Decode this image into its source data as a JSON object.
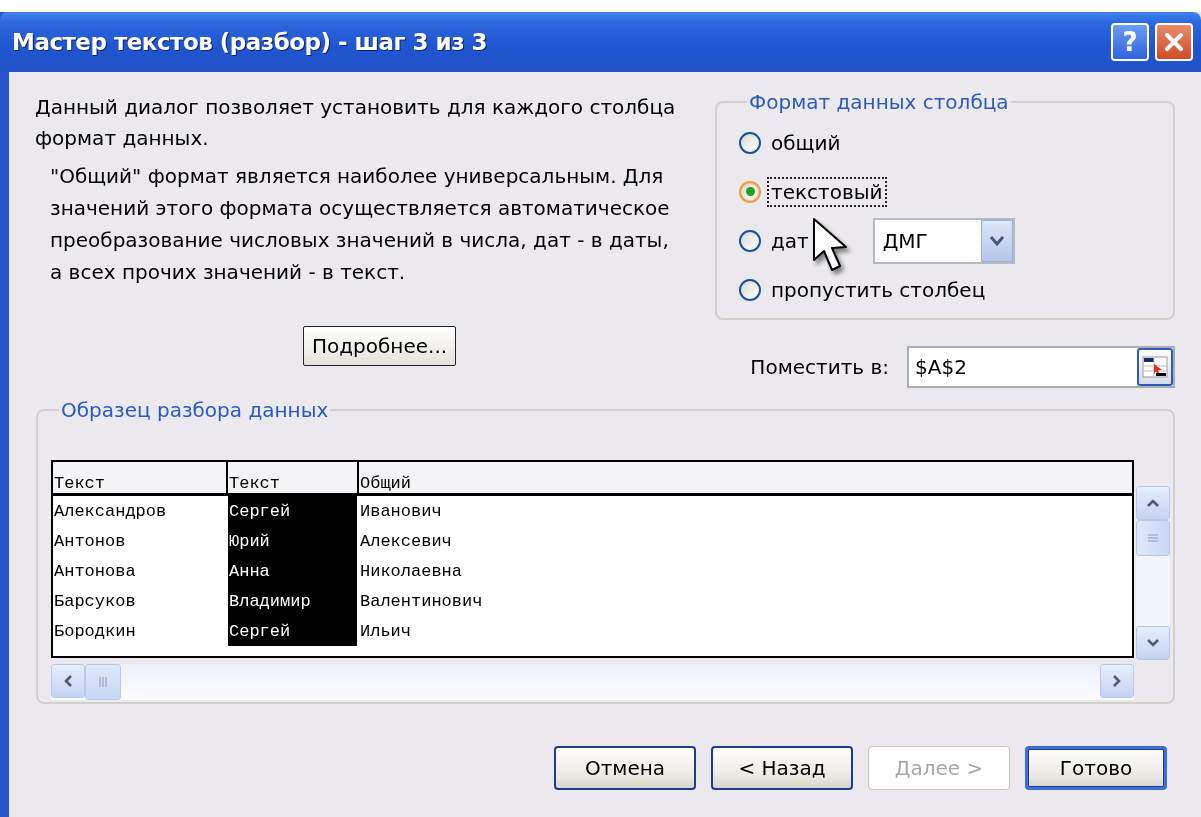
{
  "window": {
    "title": "Мастер текстов (разбор) - шаг 3 из 3",
    "help_button": {
      "label": "?"
    }
  },
  "description": "Данный диалог позволяет установить для каждого столбца формат данных.",
  "note": "\"Общий\" формат является наиболее универсальным. Для значений этого формата осуществляется автоматическое преобразование числовых значений в числа, дат - в даты, а всех прочих значений - в текст.",
  "details_button": {
    "label": "Подробнее..."
  },
  "column_format": {
    "title": "Формат данных столбца",
    "options": [
      {
        "kind": "plain",
        "label": "общий",
        "selected": false,
        "focused": false
      },
      {
        "kind": "plain",
        "label": "текстовый",
        "selected": true,
        "focused": true
      },
      {
        "kind": "date",
        "label": "дат",
        "selected": false,
        "focused": false,
        "date_format": "ДМГ"
      },
      {
        "kind": "plain",
        "label": "пропустить столбец",
        "selected": false,
        "focused": false
      }
    ]
  },
  "destination": {
    "label": "Поместить в:",
    "value": "$A$2"
  },
  "preview": {
    "title": "Образец разбора данных",
    "columns": [
      {
        "type": "Текст",
        "selected": false
      },
      {
        "type": "Текст",
        "selected": true
      },
      {
        "type": "Общий",
        "selected": false
      }
    ],
    "rows": [
      [
        "Александров",
        "Сергей",
        "Иванович"
      ],
      [
        "Антонов",
        "Юрий",
        "Алексевич"
      ],
      [
        "Антонова",
        "Анна",
        "Николаевна"
      ],
      [
        "Барсуков",
        "Владимир",
        "Валентинович"
      ],
      [
        "Бородкин",
        "Сергей",
        "Ильич"
      ]
    ]
  },
  "buttons": [
    {
      "label": "Отмена",
      "disabled": false,
      "default": false
    },
    {
      "label": "< Назад",
      "disabled": false,
      "default": false
    },
    {
      "label": "Далее >",
      "disabled": true,
      "default": false
    },
    {
      "label": "Готово",
      "disabled": false,
      "default": true
    }
  ]
}
